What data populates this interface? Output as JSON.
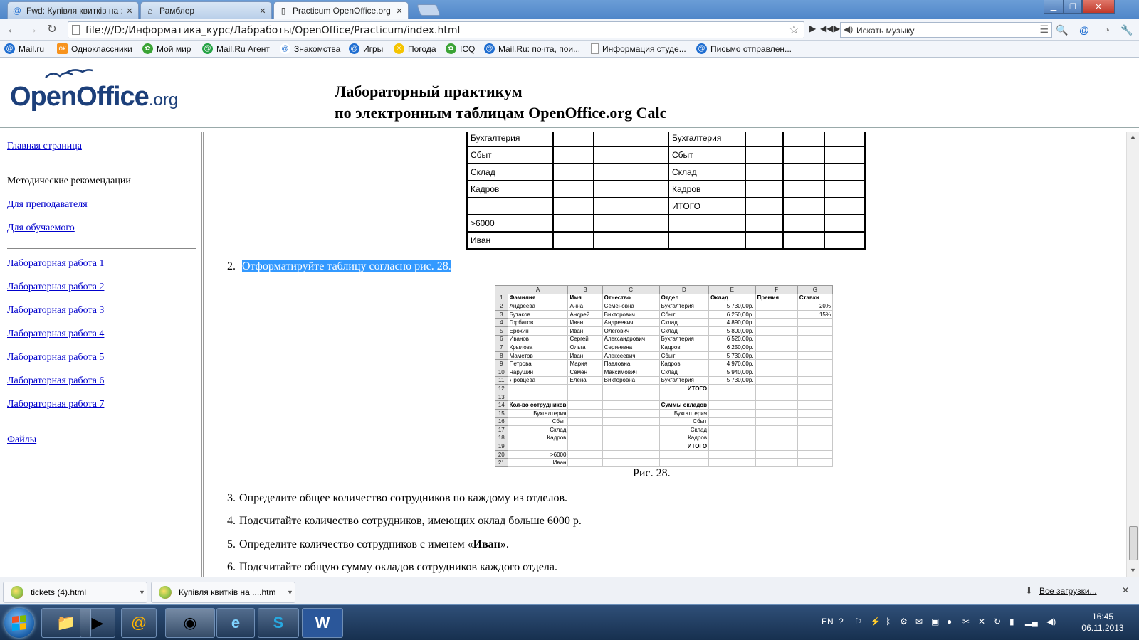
{
  "browser": {
    "tabs": [
      {
        "label": "Fwd: Купівля квитків на :",
        "icon": "mail-ru-icon"
      },
      {
        "label": "Рамблер",
        "icon": "home-icon"
      },
      {
        "label": "Practicum OpenOffice.org",
        "icon": "page-icon"
      }
    ],
    "url": "file:///D:/Информатика_курс/Лабработы/OpenOffice/Practicum/index.html",
    "music_search_placeholder": "Искать музыку",
    "bookmarks": [
      {
        "label": "Mail.ru",
        "color": "#1f6ed1",
        "glyph": "@"
      },
      {
        "label": "Одноклассники",
        "color": "#f7931e",
        "glyph": "ok"
      },
      {
        "label": "Мой мир",
        "color": "#3aa335",
        "glyph": "✿"
      },
      {
        "label": "Mail.Ru Агент",
        "color": "#25a244",
        "glyph": "@"
      },
      {
        "label": "Знакомства",
        "color": "#ffffff",
        "glyph": "@"
      },
      {
        "label": "Игры",
        "color": "#1f6ed1",
        "glyph": "@"
      },
      {
        "label": "Погода",
        "color": "#f5c400",
        "glyph": "☀"
      },
      {
        "label": "ICQ",
        "color": "#3aa335",
        "glyph": "✿"
      },
      {
        "label": "Mail.Ru: почта, пои...",
        "color": "#1f6ed1",
        "glyph": "@"
      },
      {
        "label": "Информация студе...",
        "color": "#ffffff",
        "glyph": ""
      },
      {
        "label": "Письмо отправлен...",
        "color": "#1f6ed1",
        "glyph": "@"
      }
    ]
  },
  "page": {
    "logo_text": "OpenOffice",
    "logo_suffix": ".org",
    "title_line1": "Лабораторный практикум",
    "title_line2": "по электронным таблицам OpenOffice.org Calc"
  },
  "sidebar": {
    "home": "Главная страница",
    "methodics": "Методические рекомендации",
    "for_teacher": "Для преподавателя",
    "for_student": "Для обучаемого",
    "labs": [
      "Лабораторная работа 1",
      "Лабораторная работа 2",
      "Лабораторная работа 3",
      "Лабораторная работа 4",
      "Лабораторная работа 5",
      "Лабораторная работа 6",
      "Лабораторная работа 7"
    ],
    "files": "Файлы"
  },
  "top_table": {
    "rows": [
      [
        "Бухгалтерия",
        "",
        "",
        "Бухгалтерия",
        "",
        "",
        ""
      ],
      [
        "Сбыт",
        "",
        "",
        "Сбыт",
        "",
        "",
        ""
      ],
      [
        "Склад",
        "",
        "",
        "Склад",
        "",
        "",
        ""
      ],
      [
        "Кадров",
        "",
        "",
        "Кадров",
        "",
        "",
        ""
      ],
      [
        "",
        "",
        "",
        "ИТОГО",
        "",
        "",
        ""
      ],
      [
        ">6000",
        "",
        "",
        "",
        "",
        "",
        ""
      ],
      [
        "Иван",
        "",
        "",
        "",
        "",
        "",
        ""
      ]
    ]
  },
  "steps": {
    "s2_num": "2.",
    "s2_text": "Отформатируйте таблицу согласно рис. 28.",
    "caption": "Рис. 28.",
    "s3_num": "3.",
    "s3_text": "Определите общее количество сотрудников по каждому из отделов.",
    "s4_num": "4.",
    "s4_text": "Подсчитайте количество сотрудников, имеющих оклад больше 6000 р.",
    "s5_num": "5.",
    "s5_pre": "Определите количество сотрудников с именем «",
    "s5_bold": "Иван",
    "s5_post": "».",
    "s6_num": "6.",
    "s6_text": "Подсчитайте общую сумму окладов сотрудников каждого отдела."
  },
  "sheet": {
    "columns": [
      "",
      "A",
      "B",
      "C",
      "D",
      "E",
      "F",
      "G"
    ],
    "rows": [
      [
        "1",
        "Фамилия",
        "Имя",
        "Отчество",
        "Отдел",
        "Оклад",
        "Премия",
        "Ставки"
      ],
      [
        "2",
        "Андреева",
        "Анна",
        "Семеновна",
        "Бухгалтерия",
        "5 730,00р.",
        "",
        "20%"
      ],
      [
        "3",
        "Бутаков",
        "Андрей",
        "Викторович",
        "Сбыт",
        "6 250,00р.",
        "",
        "15%"
      ],
      [
        "4",
        "Горбатов",
        "Иван",
        "Андреевич",
        "Склад",
        "4 890,00р.",
        "",
        ""
      ],
      [
        "5",
        "Ерохин",
        "Иван",
        "Олегович",
        "Склад",
        "5 800,00р.",
        "",
        ""
      ],
      [
        "6",
        "Иванов",
        "Сергей",
        "Александрович",
        "Бухгалтерия",
        "6 520,00р.",
        "",
        ""
      ],
      [
        "7",
        "Крылова",
        "Ольга",
        "Сергеевна",
        "Кадров",
        "6 250,00р.",
        "",
        ""
      ],
      [
        "8",
        "Маметов",
        "Иван",
        "Алексеевич",
        "Сбыт",
        "5 730,00р.",
        "",
        ""
      ],
      [
        "9",
        "Петрова",
        "Мария",
        "Павловна",
        "Кадров",
        "4 970,00р.",
        "",
        ""
      ],
      [
        "10",
        "Чарушин",
        "Семен",
        "Максимович",
        "Склад",
        "5 940,00р.",
        "",
        ""
      ],
      [
        "11",
        "Яровцева",
        "Елена",
        "Викторовна",
        "Бухгалтерия",
        "5 730,00р.",
        "",
        ""
      ],
      [
        "12",
        "",
        "",
        "",
        "ИТОГО",
        "",
        "",
        ""
      ],
      [
        "13",
        "",
        "",
        "",
        "",
        "",
        "",
        ""
      ],
      [
        "14",
        "Кол-во сотрудников",
        "",
        "",
        "Суммы окладов",
        "",
        "",
        ""
      ],
      [
        "15",
        "Бухгалтерия",
        "",
        "",
        "Бухгалтерия",
        "",
        "",
        ""
      ],
      [
        "16",
        "Сбыт",
        "",
        "",
        "Сбыт",
        "",
        "",
        ""
      ],
      [
        "17",
        "Склад",
        "",
        "",
        "Склад",
        "",
        "",
        ""
      ],
      [
        "18",
        "Кадров",
        "",
        "",
        "Кадров",
        "",
        "",
        ""
      ],
      [
        "19",
        "",
        "",
        "",
        "ИТОГО",
        "",
        "",
        ""
      ],
      [
        "20",
        ">6000",
        "",
        "",
        "",
        "",
        "",
        ""
      ],
      [
        "21",
        "Иван",
        "",
        "",
        "",
        "",
        "",
        ""
      ]
    ]
  },
  "downloads": {
    "items": [
      "tickets (4).html",
      "Купівля квитків на ....htm"
    ],
    "all_label": "Все загрузки..."
  },
  "taskbar": {
    "lang": "EN",
    "time": "16:45",
    "date": "06.11.2013"
  }
}
